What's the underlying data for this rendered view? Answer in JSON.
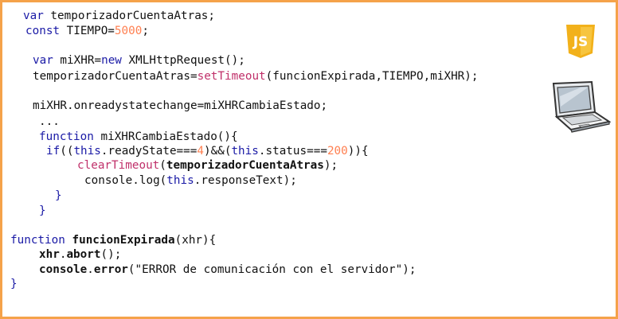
{
  "icons": [
    "js-logo-icon",
    "laptop-icon"
  ],
  "colors": {
    "border": "#f5a24a",
    "keyword": "#1a1aa6",
    "number": "#ff7f50",
    "function_call": "#c0306a",
    "js_logo": "#f2b11b"
  },
  "js_logo_text": "JS",
  "code_lines": [
    {
      "indent": 26,
      "tokens": [
        {
          "t": "var",
          "c": "kw"
        },
        {
          "t": " temporizadorCuentaAtras;",
          "c": "def"
        }
      ]
    },
    {
      "indent": 29,
      "tokens": [
        {
          "t": "const",
          "c": "kw"
        },
        {
          "t": " TIEMPO=",
          "c": "def"
        },
        {
          "t": "5000",
          "c": "num"
        },
        {
          "t": ";",
          "c": "def"
        }
      ]
    },
    {
      "indent": 0,
      "tokens": []
    },
    {
      "indent": 38,
      "tokens": [
        {
          "t": "var",
          "c": "kw"
        },
        {
          "t": " miXHR=",
          "c": "def"
        },
        {
          "t": "new",
          "c": "kw"
        },
        {
          "t": " XMLHttpRequest();",
          "c": "def"
        }
      ]
    },
    {
      "indent": 38,
      "tokens": [
        {
          "t": "temporizadorCuentaAtras=",
          "c": "def"
        },
        {
          "t": "setTimeout",
          "c": "fn"
        },
        {
          "t": "(funcionExpirada,TIEMPO,miXHR);",
          "c": "def"
        }
      ]
    },
    {
      "indent": 0,
      "tokens": []
    },
    {
      "indent": 38,
      "tokens": [
        {
          "t": "miXHR.onreadystatechange=miXHRCambiaEstado;",
          "c": "def"
        }
      ]
    },
    {
      "indent": 46,
      "tokens": [
        {
          "t": "...",
          "c": "def"
        }
      ]
    },
    {
      "indent": 46,
      "tokens": [
        {
          "t": "function",
          "c": "kw"
        },
        {
          "t": " miXHRCambiaEstado(){",
          "c": "def"
        }
      ]
    },
    {
      "indent": 55,
      "tokens": [
        {
          "t": "if",
          "c": "kw"
        },
        {
          "t": "((",
          "c": "def"
        },
        {
          "t": "this",
          "c": "kw"
        },
        {
          "t": ".readyState===",
          "c": "def"
        },
        {
          "t": "4",
          "c": "num"
        },
        {
          "t": ")&&(",
          "c": "def"
        },
        {
          "t": "this",
          "c": "kw"
        },
        {
          "t": ".status===",
          "c": "def"
        },
        {
          "t": "200",
          "c": "num"
        },
        {
          "t": ")){",
          "c": "def"
        }
      ]
    },
    {
      "indent": 94,
      "tokens": [
        {
          "t": "clearTimeout",
          "c": "fn"
        },
        {
          "t": "(",
          "c": "def"
        },
        {
          "t": "temporizadorCuentaAtras",
          "c": "def-b"
        },
        {
          "t": ");",
          "c": "def"
        }
      ]
    },
    {
      "indent": 103,
      "tokens": [
        {
          "t": "console.log(",
          "c": "def"
        },
        {
          "t": "this",
          "c": "kw"
        },
        {
          "t": ".responseText);",
          "c": "def"
        }
      ]
    },
    {
      "indent": 66,
      "tokens": [
        {
          "t": "}",
          "c": "kw"
        }
      ]
    },
    {
      "indent": 46,
      "tokens": [
        {
          "t": "}",
          "c": "kw"
        }
      ]
    },
    {
      "indent": 0,
      "tokens": []
    },
    {
      "indent": 10,
      "tokens": [
        {
          "t": "function",
          "c": "kw"
        },
        {
          "t": " ",
          "c": "def"
        },
        {
          "t": "funcionExpirada",
          "c": "def-b"
        },
        {
          "t": "(xhr){",
          "c": "def"
        }
      ]
    },
    {
      "indent": 46,
      "tokens": [
        {
          "t": "xhr",
          "c": "def-b"
        },
        {
          "t": ".",
          "c": "def"
        },
        {
          "t": "abort",
          "c": "def-b"
        },
        {
          "t": "();",
          "c": "def"
        }
      ]
    },
    {
      "indent": 46,
      "tokens": [
        {
          "t": "console",
          "c": "def-b"
        },
        {
          "t": ".",
          "c": "def"
        },
        {
          "t": "error",
          "c": "def-b"
        },
        {
          "t": "(\"ERROR de comunicación con el servidor\");",
          "c": "str"
        }
      ]
    },
    {
      "indent": 10,
      "tokens": [
        {
          "t": "}",
          "c": "kw"
        }
      ]
    }
  ]
}
